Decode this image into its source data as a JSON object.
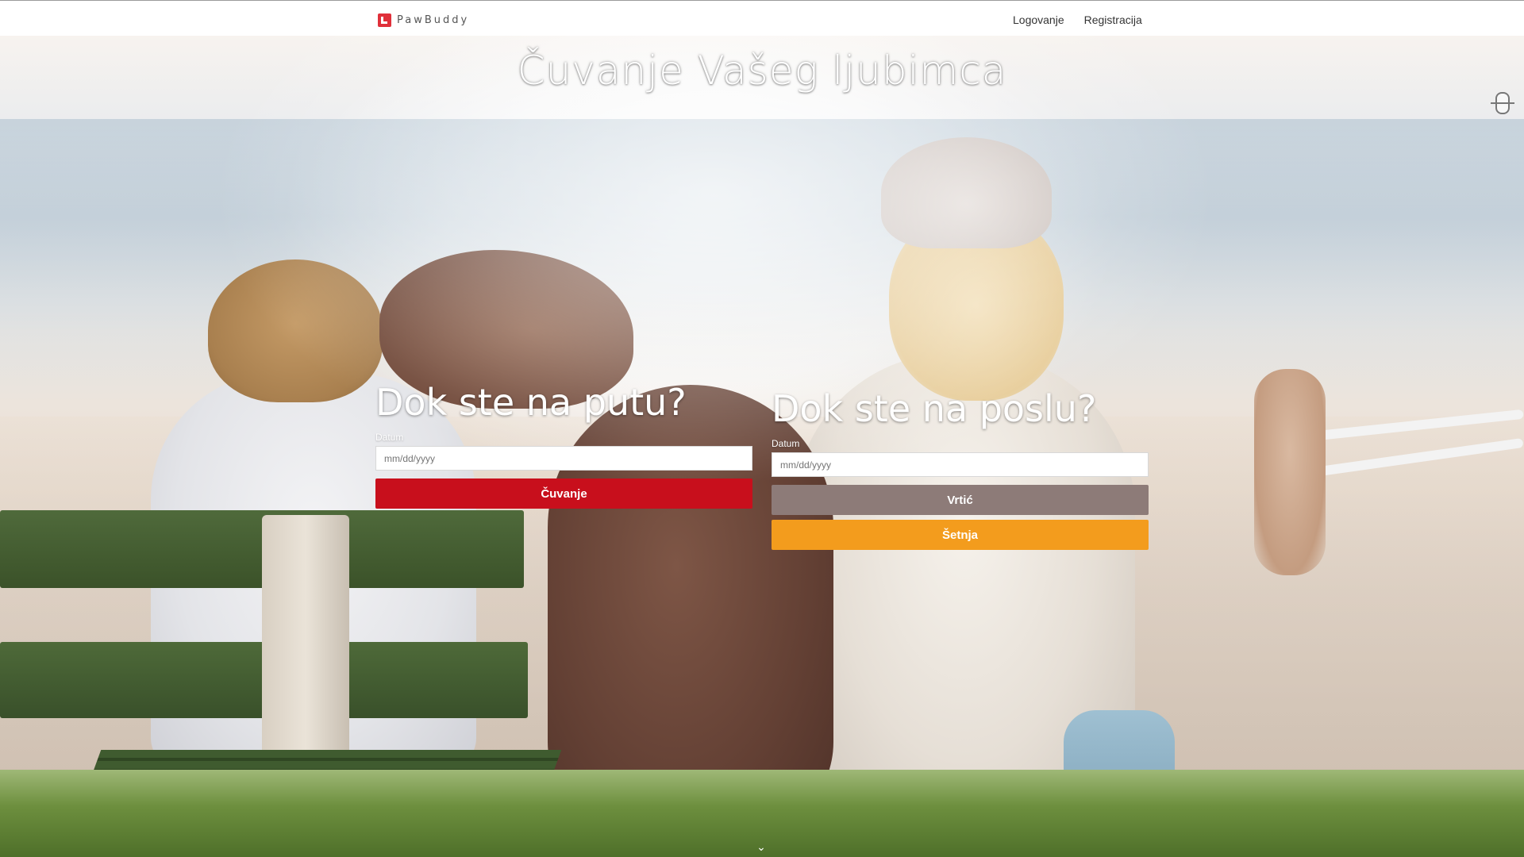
{
  "brand": {
    "name": "PawBuddy",
    "logo_icon": "pawbuddy-logo-icon",
    "logo_color": "#e0303a"
  },
  "nav": {
    "items": [
      {
        "label": "Logovanje"
      },
      {
        "label": "Registracija"
      }
    ]
  },
  "hero": {
    "title": "Čuvanje Vašeg ljubimca"
  },
  "travel_panel": {
    "heading": "Dok ste na putu?",
    "date_label": "Datum",
    "date_placeholder": "mm/dd/yyyy",
    "buttons": [
      {
        "label": "Čuvanje",
        "color": "#c80f1c"
      }
    ]
  },
  "work_panel": {
    "heading": "Dok ste na poslu?",
    "date_label": "Datum",
    "date_placeholder": "mm/dd/yyyy",
    "buttons": [
      {
        "label": "Vrtić",
        "color": "#8d7b78"
      },
      {
        "label": "Šetnja",
        "color": "#f39c1d"
      }
    ]
  },
  "icons": {
    "side_handle": "move-handle-icon",
    "scroll_down": "chevron-down-icon"
  }
}
